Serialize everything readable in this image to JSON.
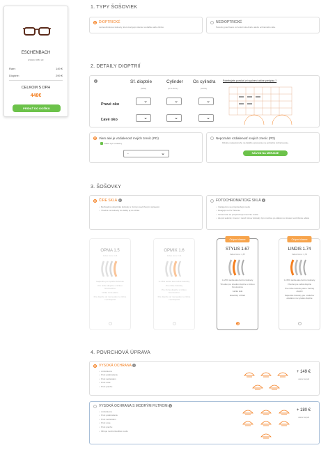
{
  "product": {
    "brand": "ESCHENBACH",
    "model": "ESSEN 3683 HF",
    "frame_label": "Rám:",
    "frame_price": "149 €",
    "lens_label": "Dioptrie:",
    "lens_price": "299 €",
    "total_label": "CELKOM S DPH",
    "total_price": "448€",
    "cart_button": "PRIDAŤ DO KOŠÍKU"
  },
  "section1": {
    "title": "1. TYPY ŠOŠOVIEK",
    "options": [
      {
        "label": "DIOPTRICKÉ",
        "desc": "Jednoohniskové šošovky, ktoré korigujú videnie na diaľku alebo blízko.",
        "selected": true
      },
      {
        "label": "NEDIOPTRICKÉ",
        "desc": "Šošovky používané vo funkcii slnečného alebo ochranného skla.",
        "selected": false
      }
    ]
  },
  "section2": {
    "title": "2. DETAILY DIOPTRIÍ",
    "col1": "Sf. dioptrie",
    "col1_sub": "(SPH)",
    "col2": "Cylinder",
    "col2_sub": "(CYL/ACL)",
    "col3": "Os cylindra",
    "col3_sub": "(AXIS)",
    "row1": "Pravé oko",
    "row2": "Ľavé oko",
    "help_link": "Potrebujete pomôcť pri vyplnení online predpisu ?",
    "same_label": "Viem aké je vzdialenosť mojich zreníc (PD)",
    "same_check": "Môže byť rozdielny",
    "same_value": "-",
    "pd_label": "Nepoznám vzdialenosť svojich zreníc (PD)",
    "pd_desc": "Kliknite nasledovného na tlačidlo upisovanie na pohodlné zobrazovanie.",
    "pd_button": "NÁVOD NA MERANIE"
  },
  "section3": {
    "title": "3. ŠOŠOVKY",
    "clear_label": "ČÍRE SKLÁ",
    "clear_items": [
      "Bezfarebné dioptrické šošovky s rôznym povrchovým úpravami",
      "Vhodné na šošovky do diaľky aj do blízka"
    ],
    "photo_label": "FOTOCHROMATICKÉ SKLÁ",
    "photo_items": [
      "Inteligentné sa prispôsobujú svetlu",
      "Reagujú na UV žiarenie",
      "Stmavnutie sa prispôsobuje intenzite svetla",
      "Za pár sekúnd, zmenu z dvoch tónov šošovky tým mnohou po slabom sú tmavé na zníženie odletu"
    ],
    "lenses": [
      {
        "name": "OPMA 1.5",
        "index": "Index lomu: 1,5",
        "items": [
          "Najtenšie pre optickú šošovku",
          "Pre nízke dioptrie s nízkou hmotnosťou",
          "Nízka cena alebo",
          "Pre dioptrie od menej ako na rôzne +2,0 dioptrie"
        ],
        "badge": "",
        "state": "dim"
      },
      {
        "name": "OPMIX 1.6",
        "index": "Index lomu: 1,6",
        "items": [
          "0–15% tenšie ako bežné šošovky",
          "Pre nízke šošovky",
          "Pre rôzne dioptrie s nízkou hmotnosťou",
          "Pre dioptrie od menej ako na rôzne +2,0 dioptrie"
        ],
        "badge": "",
        "state": "dim"
      },
      {
        "name": "STYLIS 1.67",
        "index": "Index lomu: 1,67",
        "items": [
          "0–25% tenšie ako bežné šošovky",
          "Vhodné pre stredné dioptrie s nízkou hmotnosťou",
          "Ľahké sklá",
          "Estetický vzhľad"
        ],
        "badge": "Odporúčame",
        "state": "selected"
      },
      {
        "name": "LINDIS 1.74",
        "index": "Index lomu: 1,74",
        "items": [
          "0–35% tenšie ako bežné šošovky",
          "Vhodné pre veľké dioptrie",
          "Pre nízke šošovky ako v bežnej dioptrii",
          "Najtenšie šošovky pre nositeľov okuliarov na vysoké dioptrie"
        ],
        "badge": "Odporúčame",
        "state": "normal"
      }
    ]
  },
  "section4": {
    "title": "4. POVRCHOVÁ ÚPRAVA",
    "options": [
      {
        "label": "VYSOKÁ OCHRANA",
        "items": [
          "Antireflexné",
          "Proti poškriabaniu",
          "Proti nečistotám",
          "Proti vode",
          "Proti prachu"
        ],
        "price": "+ 149 €",
        "note": "cena za pár",
        "selected": true
      },
      {
        "label": "VYSOKÁ OCHRANA S MODRÝM FILTROM",
        "items": [
          "Antireflexné",
          "Proti poškriabaniu",
          "Proti nečistotám",
          "Proti vode",
          "Proti prachu",
          "Filtruje modré škodlivé svetlo"
        ],
        "price": "+ 180 €",
        "note": "cena za pár",
        "selected": false
      }
    ]
  },
  "colors": {
    "accent": "#f47f20",
    "green": "#6cc24a",
    "blue_border": "#a8bfd8"
  }
}
